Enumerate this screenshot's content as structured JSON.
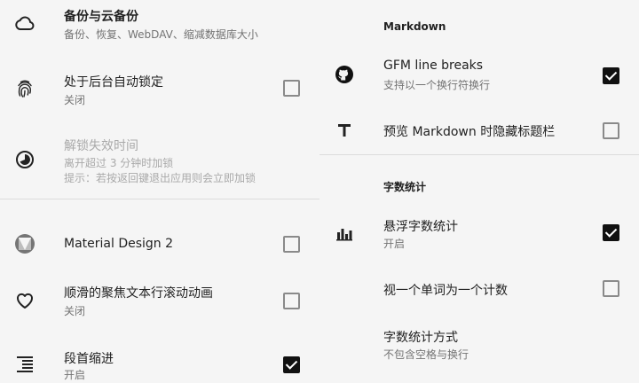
{
  "left": {
    "backup": {
      "title": "备份与云备份",
      "summary": "备份、恢复、WebDAV、缩减数据库大小",
      "icon": "cloud-icon"
    },
    "auto_lock": {
      "title": "处于后台自动锁定",
      "summary": "关闭",
      "icon": "fingerprint-icon",
      "checked": false
    },
    "unlock_timeout": {
      "title": "解锁失效时间",
      "summary_line1": "离开超过 3 分钟时加锁",
      "summary_line2": "提示：若按返回键退出应用则会立即加锁",
      "icon": "timer-icon",
      "enabled": false
    },
    "material": {
      "title": "Material Design 2",
      "icon": "material-design-icon",
      "checked": false
    },
    "smooth_scroll": {
      "title": "顺滑的聚焦文本行滚动动画",
      "summary": "关闭",
      "icon": "heart-icon",
      "checked": false
    },
    "indent": {
      "title": "段首缩进",
      "summary": "开启",
      "icon": "indent-icon",
      "checked": true
    }
  },
  "right": {
    "markdown_category": "Markdown",
    "gfm": {
      "title": "GFM line breaks",
      "summary": "支持以一个换行符换行",
      "icon": "github-icon",
      "checked": true
    },
    "hide_title": {
      "title": "预览 Markdown 时隐藏标题栏",
      "icon": "text-t-icon",
      "checked": false
    },
    "wordcount_category": "字数统计",
    "floating_count": {
      "title": "悬浮字数统计",
      "summary": "开启",
      "icon": "bar-chart-icon",
      "checked": true
    },
    "word_as_one": {
      "title": "视一个单词为一个计数",
      "checked": false
    },
    "count_method": {
      "title": "字数统计方式",
      "summary": "不包含空格与换行"
    }
  },
  "colors": {
    "checked": "#111111",
    "unchecked_border": "#8a8a8a",
    "background": "#f5f5f5",
    "divider": "#dcdcdc"
  }
}
